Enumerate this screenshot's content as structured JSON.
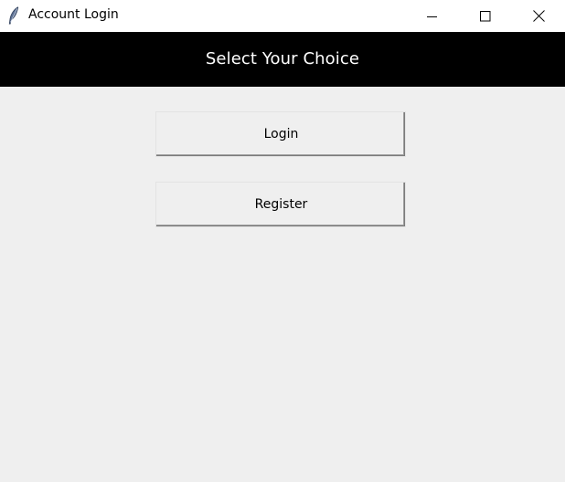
{
  "window": {
    "title": "Account Login",
    "icon": "feather-icon",
    "controls": {
      "minimize_icon": "minimize-icon",
      "maximize_icon": "maximize-icon",
      "close_icon": "close-icon"
    }
  },
  "header": {
    "title": "Select Your Choice",
    "background": "#000000",
    "text_color": "#ffffff"
  },
  "buttons": {
    "login_label": "Login",
    "register_label": "Register"
  },
  "colors": {
    "body_background": "#efefef",
    "titlebar_background": "#ffffff"
  }
}
